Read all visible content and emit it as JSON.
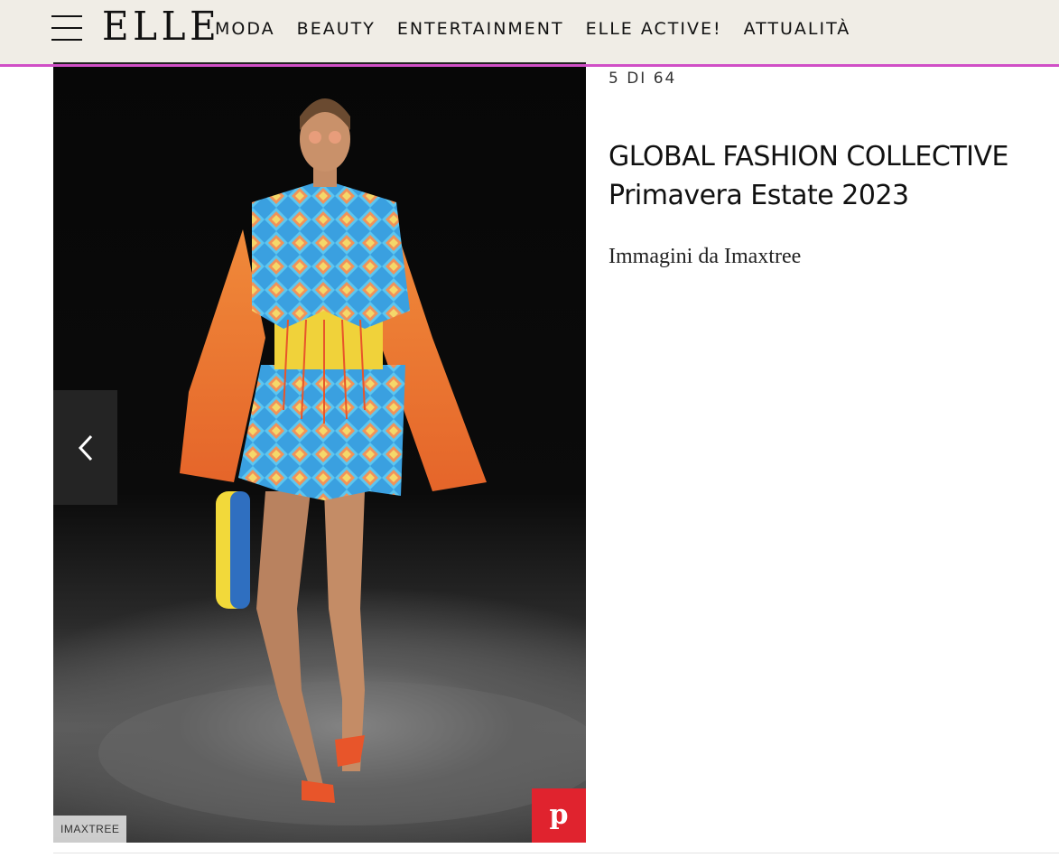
{
  "header": {
    "logo": "ELLE",
    "nav": [
      "MODA",
      "BEAUTY",
      "ENTERTAINMENT",
      "ELLE ACTIVE!",
      "ATTUALITÀ"
    ],
    "accent_color": "#d04fc6",
    "background": "#f0ede6"
  },
  "gallery": {
    "counter": "5 DI 64",
    "image_credit": "IMAXTREE",
    "prev_icon": "chevron-left-icon",
    "share_icon": "pinterest-icon",
    "share_color": "#e0232e"
  },
  "slide": {
    "title": "GLOBAL FASHION COLLECTIVE",
    "subtitle": "Primavera Estate 2023",
    "caption": "Immagini da Imaxtree"
  }
}
